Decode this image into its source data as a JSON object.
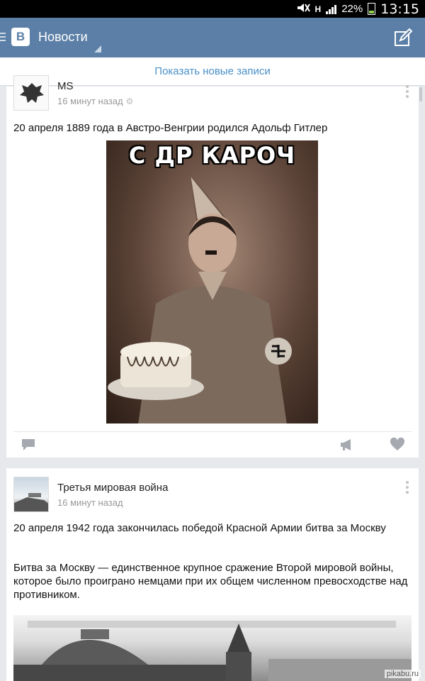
{
  "status_bar": {
    "battery": "22%",
    "time": "13:15",
    "network": "H"
  },
  "app_bar": {
    "title": "Новости",
    "logo": "В"
  },
  "show_new": "Показать новые записи",
  "posts": [
    {
      "author": "MS",
      "time": "16 минут назад",
      "text": "20 апреля 1889 года в Австро-Венгрии родился Адольф Гитлер",
      "image_caption": "С ДР КАРОЧ"
    },
    {
      "author": "Третья мировая война",
      "time": "16 минут назад",
      "text1": "20 апреля 1942 года закончилась победой Красной Армии битва за Москву",
      "text2": "Битва за Москву — единственное крупное сражение Второй мировой войны, которое было проиграно немцами при их общем численном превосходстве над противником."
    }
  ],
  "watermark": "pikabu.ru",
  "colors": {
    "brand": "#5b7fa6",
    "link": "#4a90c8",
    "background": "#e7e8ec"
  }
}
